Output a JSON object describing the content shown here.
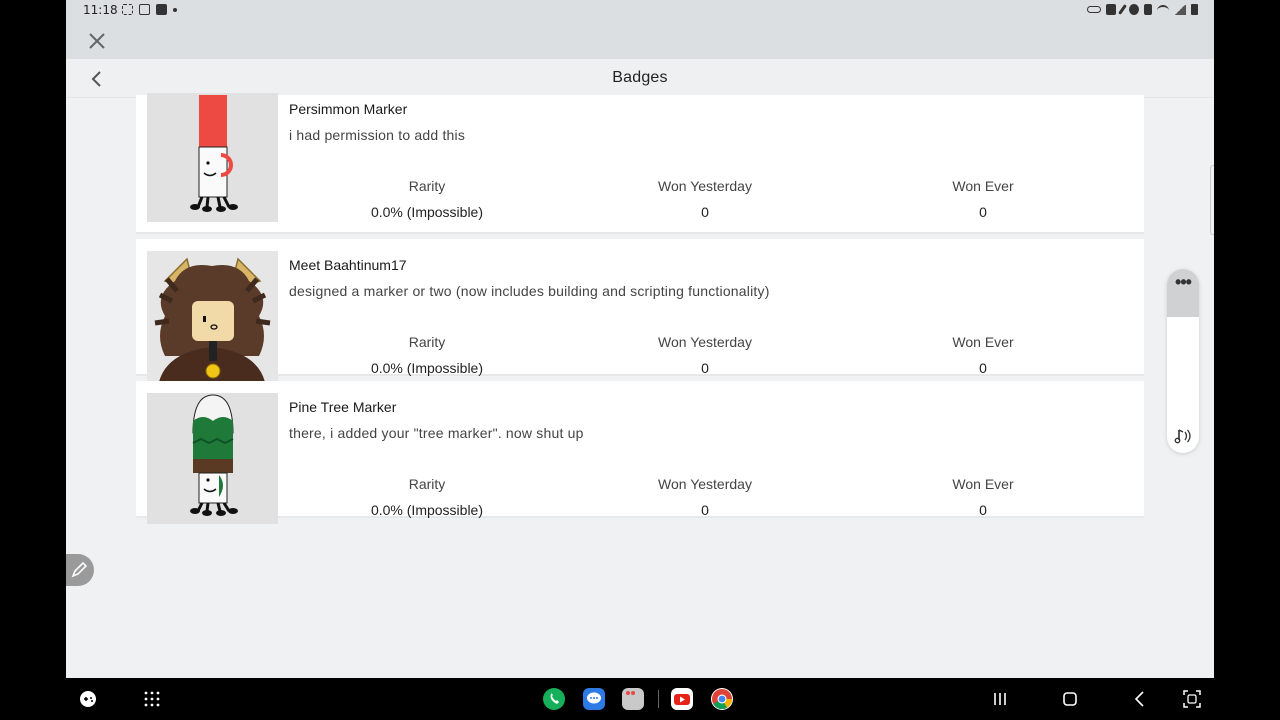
{
  "status_bar": {
    "time": "11:18",
    "left_icons": [
      "screenshot-icon",
      "screen-record-icon",
      "app-notification-icon",
      "dot-icon"
    ],
    "right_icons": [
      "key-icon",
      "nfc-icon",
      "edit-icon",
      "alarm-icon",
      "mute-icon",
      "wifi-icon",
      "signal-icon",
      "battery-icon"
    ]
  },
  "header": {
    "title": "Badges"
  },
  "badges": [
    {
      "name": "Persimmon Marker",
      "description": "i had permission to add this",
      "rarity_label": "Rarity",
      "rarity_value": "0.0% (Impossible)",
      "won_yesterday_label": "Won Yesterday",
      "won_yesterday_value": "0",
      "won_ever_label": "Won Ever",
      "won_ever_value": "0",
      "image": "red-marker-image"
    },
    {
      "name": "Meet Baahtinum17",
      "description": "designed a marker or two (now includes building and scripting functionality)",
      "rarity_label": "Rarity",
      "rarity_value": "0.0% (Impossible)",
      "won_yesterday_label": "Won Yesterday",
      "won_yesterday_value": "0",
      "won_ever_label": "Won Ever",
      "won_ever_value": "0",
      "image": "avatar-head-image"
    },
    {
      "name": "Pine Tree Marker",
      "description": "there, i added your \"tree marker\". now shut up",
      "rarity_label": "Rarity",
      "rarity_value": "0.0% (Impossible)",
      "won_yesterday_label": "Won Yesterday",
      "won_yesterday_value": "0",
      "won_ever_label": "Won Ever",
      "won_ever_value": "0",
      "image": "pine-tree-marker-image"
    }
  ],
  "floating_panel": {
    "menu_icon": "more-dots-icon",
    "bottom_icon": "music-note-icon"
  },
  "nav_bar": {
    "left_icons": [
      "game-controller-icon",
      "apps-grid-icon"
    ],
    "dock_apps": [
      "phone-app-icon",
      "messages-app-icon",
      "app-folder-icon",
      "youtube-app-icon",
      "chrome-app-icon"
    ],
    "right_icons": [
      "recents-icon",
      "home-icon",
      "back-icon",
      "screen-capture-icon"
    ]
  },
  "colors": {
    "page_background": "#eff1f2",
    "card_background": "#ffffff",
    "status_bar": "#dcdfe1",
    "text_primary": "#1a1a1a",
    "text_secondary": "#444444"
  }
}
